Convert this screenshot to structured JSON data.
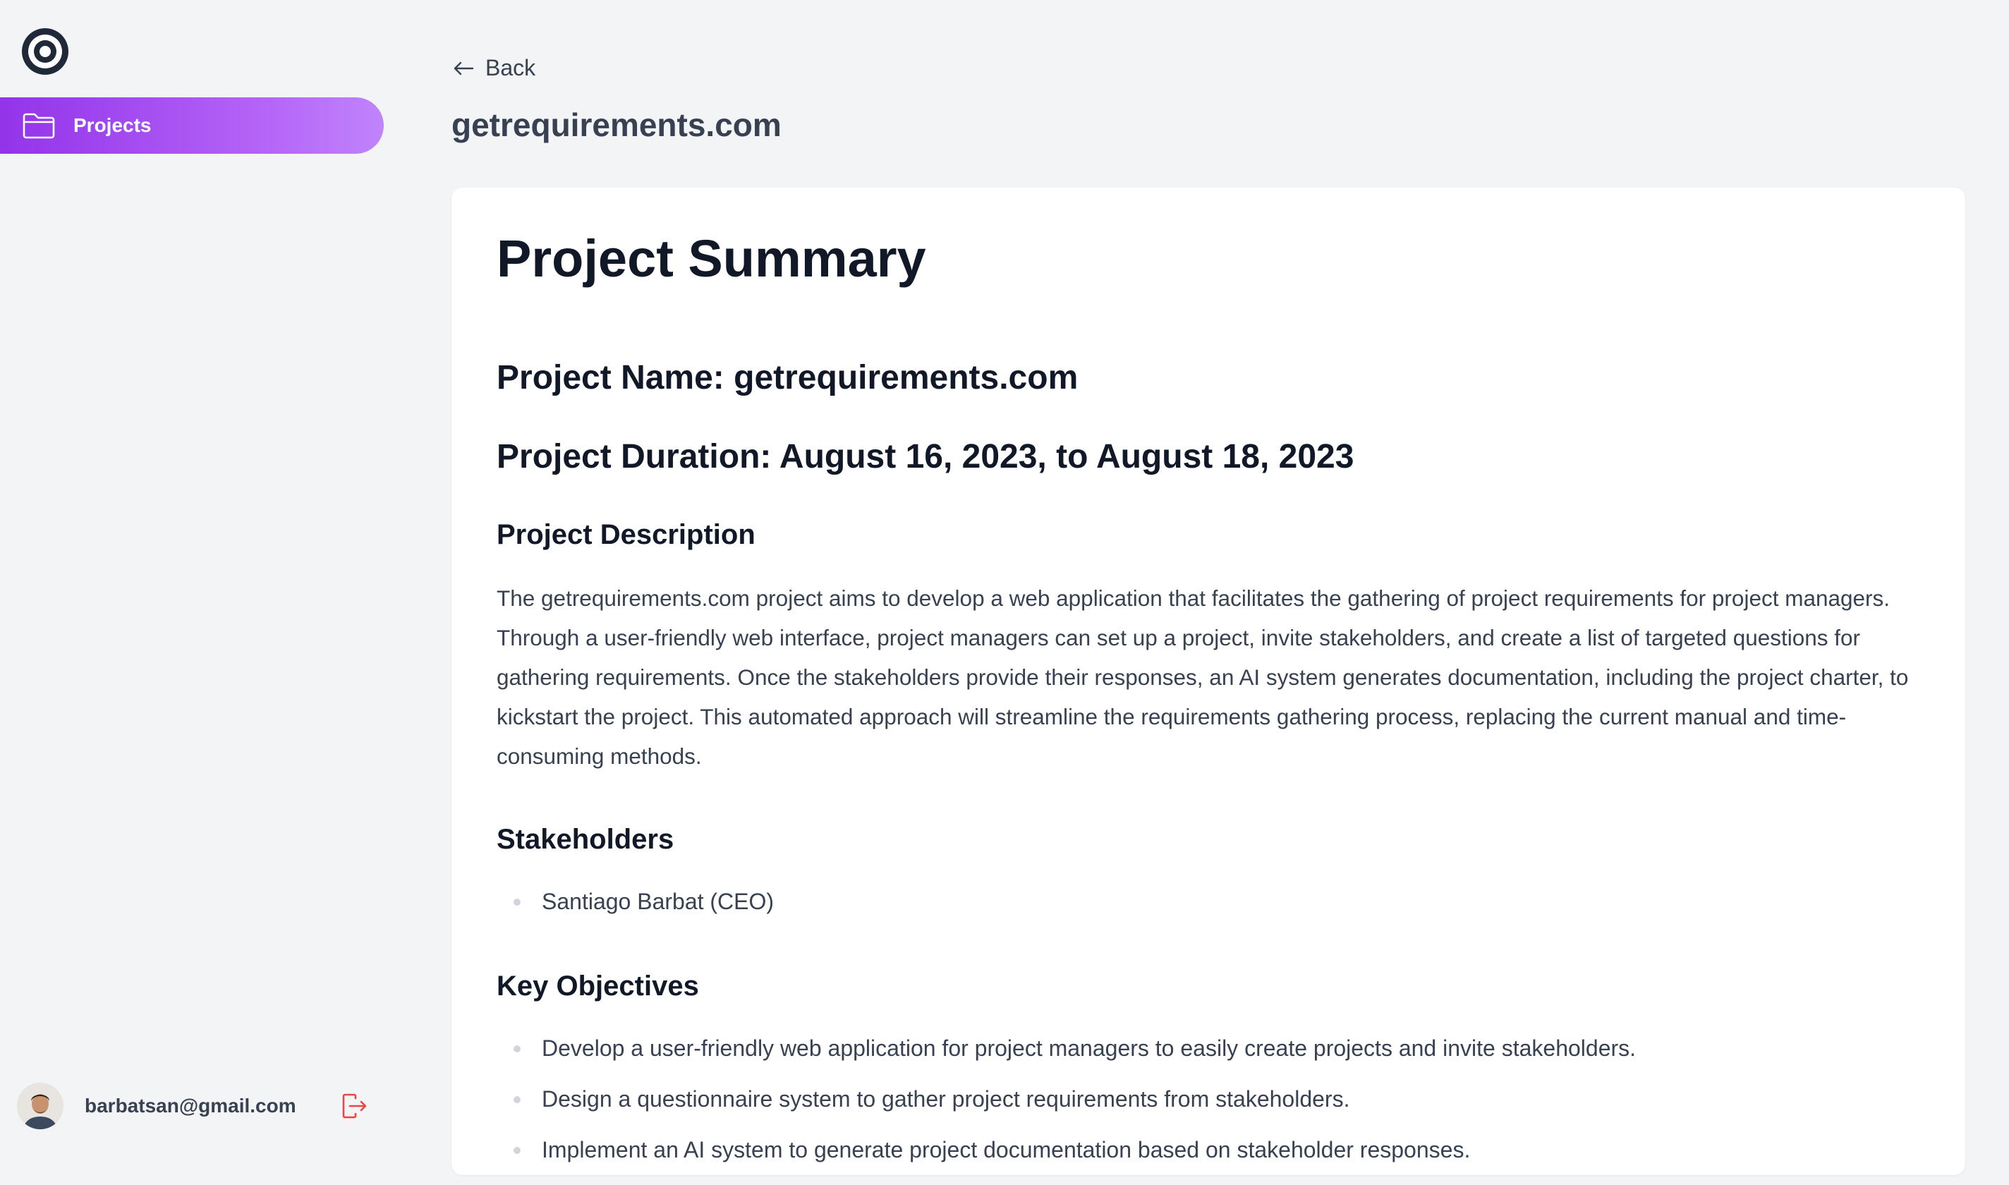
{
  "sidebar": {
    "logo_icon": "target-icon",
    "nav": [
      {
        "label": "Projects",
        "icon": "folder-icon",
        "active": true
      }
    ],
    "user": {
      "email": "barbatsan@gmail.com",
      "logout_icon": "logout-icon"
    }
  },
  "header": {
    "back_label": "Back",
    "title": "getrequirements.com"
  },
  "document": {
    "title": "Project Summary",
    "project_name": "Project Name: getrequirements.com",
    "project_duration": "Project Duration: August 16, 2023, to August 18, 2023",
    "description_heading": "Project Description",
    "description": "The getrequirements.com project aims to develop a web application that facilitates the gathering of project requirements for project managers. Through a user-friendly web interface, project managers can set up a project, invite stakeholders, and create a list of targeted questions for gathering requirements. Once the stakeholders provide their responses, an AI system generates documentation, including the project charter, to kickstart the project. This automated approach will streamline the requirements gathering process, replacing the current manual and time-consuming methods.",
    "stakeholders_heading": "Stakeholders",
    "stakeholders": [
      "Santiago Barbat (CEO)"
    ],
    "objectives_heading": "Key Objectives",
    "objectives": [
      "Develop a user-friendly web application for project managers to easily create projects and invite stakeholders.",
      "Design a questionnaire system to gather project requirements from stakeholders.",
      "Implement an AI system to generate project documentation based on stakeholder responses."
    ]
  },
  "colors": {
    "accent_start": "#9333ea",
    "accent_end": "#c084fc",
    "background": "#f3f4f6",
    "logout": "#ef4444"
  }
}
